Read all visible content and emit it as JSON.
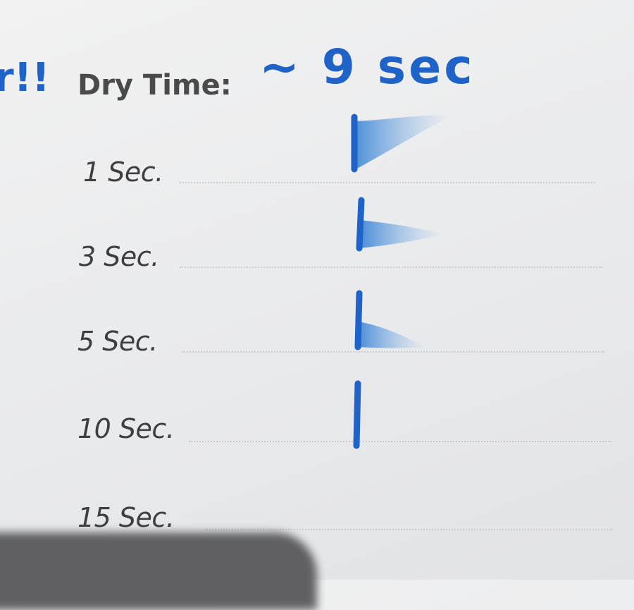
{
  "handwriting": {
    "fragment": "r!!",
    "dry_time_value": "~ 9 sec"
  },
  "form": {
    "dry_time_label": "Dry Time:",
    "rows": [
      {
        "label": "1 Sec."
      },
      {
        "label": "3 Sec."
      },
      {
        "label": "5 Sec."
      },
      {
        "label": "10 Sec."
      },
      {
        "label": "15 Sec."
      }
    ]
  },
  "colors": {
    "ink": "#1f63c9",
    "smudge": "#4a90d9",
    "paper": "#eeeeef",
    "print": "#3f3f42"
  }
}
